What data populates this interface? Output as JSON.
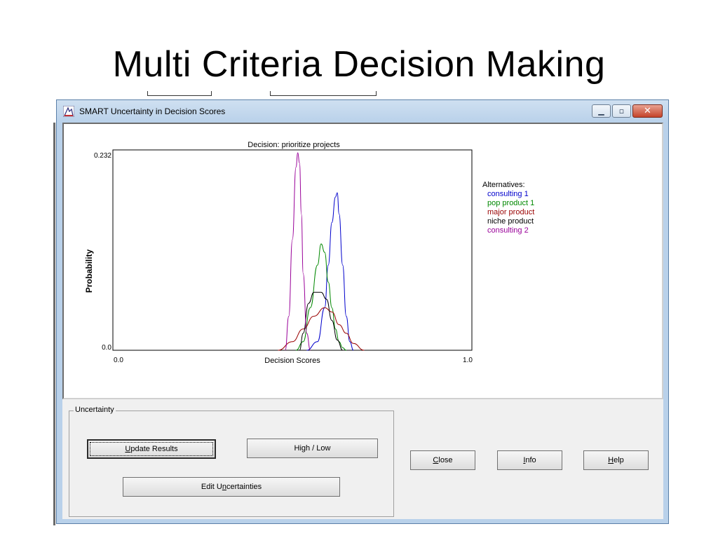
{
  "slide": {
    "title": "Multi Criteria Decision Making"
  },
  "window": {
    "title": "SMART Uncertainty in Decision Scores",
    "icon": "smart-app-icon",
    "controls": {
      "minimize": "minimize-icon",
      "maximize": "maximize-icon",
      "close": "close-icon"
    }
  },
  "chart_data": {
    "type": "line",
    "title": "Decision: prioritize projects",
    "xlabel": "Decision Scores",
    "ylabel": "Probability",
    "xlim": [
      0.0,
      1.0
    ],
    "ylim": [
      0.0,
      0.232
    ],
    "x_tick_labels": [
      "0.0",
      "1.0"
    ],
    "y_tick_labels": [
      "0.0",
      "0.232"
    ],
    "legend_title": "Alternatives:",
    "series": [
      {
        "name": "consulting 1",
        "color": "#0000cc",
        "x": [
          0.54,
          0.57,
          0.59,
          0.6,
          0.61,
          0.62,
          0.625,
          0.63,
          0.64,
          0.65,
          0.66,
          0.67
        ],
        "y": [
          0.0,
          0.01,
          0.05,
          0.1,
          0.15,
          0.18,
          0.185,
          0.16,
          0.1,
          0.04,
          0.01,
          0.0
        ]
      },
      {
        "name": "pop product 1",
        "color": "#008800",
        "x": [
          0.51,
          0.53,
          0.55,
          0.57,
          0.58,
          0.59,
          0.6,
          0.61,
          0.62,
          0.63,
          0.64,
          0.65
        ],
        "y": [
          0.0,
          0.01,
          0.05,
          0.1,
          0.125,
          0.115,
          0.08,
          0.05,
          0.025,
          0.01,
          0.003,
          0.0
        ]
      },
      {
        "name": "major product",
        "color": "#990000",
        "x": [
          0.46,
          0.5,
          0.53,
          0.56,
          0.59,
          0.61,
          0.63,
          0.65,
          0.67,
          0.7
        ],
        "y": [
          0.0,
          0.01,
          0.025,
          0.04,
          0.05,
          0.045,
          0.03,
          0.02,
          0.008,
          0.0
        ]
      },
      {
        "name": "niche product",
        "color": "#000000",
        "x": [
          0.52,
          0.53,
          0.545,
          0.56,
          0.58,
          0.595,
          0.61,
          0.625,
          0.64
        ],
        "y": [
          0.0,
          0.02,
          0.055,
          0.068,
          0.068,
          0.06,
          0.035,
          0.012,
          0.0
        ]
      },
      {
        "name": "consulting 2",
        "color": "#990099",
        "x": [
          0.48,
          0.49,
          0.5,
          0.51,
          0.515,
          0.52,
          0.525,
          0.53,
          0.54,
          0.55
        ],
        "y": [
          0.0,
          0.04,
          0.13,
          0.215,
          0.232,
          0.22,
          0.16,
          0.09,
          0.02,
          0.0
        ]
      }
    ],
    "grid": false,
    "legend_position": "right"
  },
  "uncertainty_group": {
    "label": "Uncertainty",
    "update_results": {
      "pre": "",
      "u": "U",
      "post": "pdate Results"
    },
    "high_low": "High / Low",
    "edit_uncertainties": {
      "pre": "Edit U",
      "u": "n",
      "post": "certainties"
    }
  },
  "buttons": {
    "close": {
      "u": "C",
      "post": "lose"
    },
    "info": {
      "u": "I",
      "post": "nfo"
    },
    "help": {
      "u": "H",
      "post": "elp"
    }
  }
}
